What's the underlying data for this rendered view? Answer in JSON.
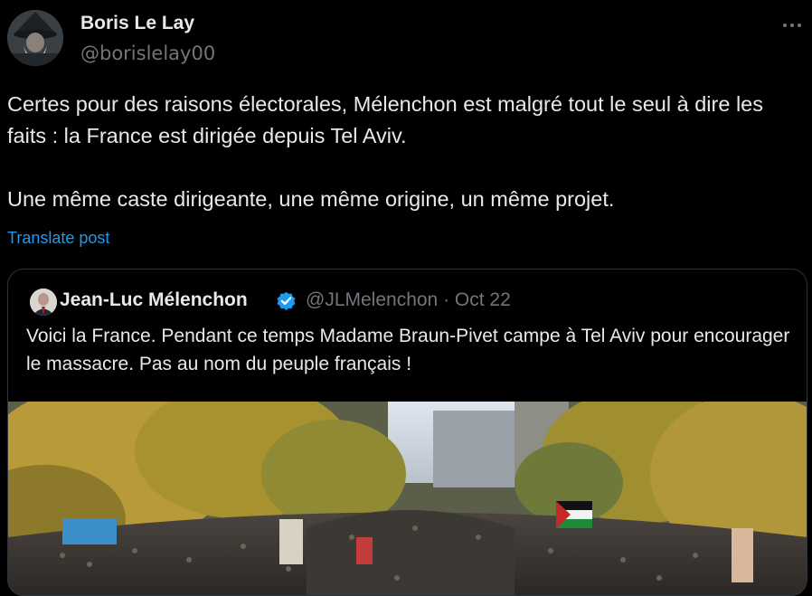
{
  "author": {
    "name": "Boris Le Lay",
    "handle": "@borislelay00"
  },
  "tweet": {
    "text": "Certes pour des raisons électorales, Mélenchon est malgré tout le seul à dire les faits : la France est dirigée depuis Tel Aviv.\n\nUne même caste dirigeante, une même origine, un même projet.",
    "translate_label": "Translate post"
  },
  "quoted": {
    "name": "Jean-Luc Mélenchon",
    "handle": "@JLMelenchon",
    "separator": "·",
    "date": "Oct 22",
    "text": "Voici la France. Pendant ce temps Madame Braun-Pivet campe à Tel Aviv pour encourager le massacre. Pas au nom du peuple français !"
  },
  "icons": {
    "more": "more-horizontal-icon",
    "verified": "verified-badge-icon"
  },
  "colors": {
    "background": "#000000",
    "text": "#e7e9ea",
    "secondary": "#71767b",
    "accent": "#1d9bf0",
    "border": "#2f3336"
  }
}
